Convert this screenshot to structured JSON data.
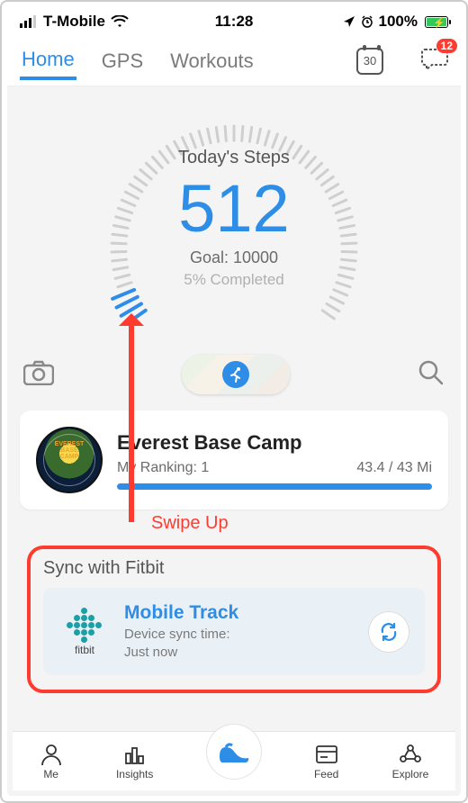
{
  "status": {
    "carrier": "T-Mobile",
    "time": "11:28",
    "battery_pct": "100%"
  },
  "topnav": {
    "tabs": [
      "Home",
      "GPS",
      "Workouts"
    ],
    "active_index": 0,
    "calendar_day": "30",
    "chat_badge": "12"
  },
  "gauge": {
    "label": "Today's Steps",
    "steps": "512",
    "goal_label": "Goal: 10000",
    "pct_label": "5% Completed",
    "pct_value": 5
  },
  "challenge": {
    "title": "Everest Base Camp",
    "patch_line1": "EVEREST",
    "patch_line2": "BASE CAMP",
    "ranking_label": "My Ranking: 1",
    "distance_label": "43.4 / 43 Mi",
    "progress_pct": 100
  },
  "annotation": {
    "swipe_label": "Swipe Up"
  },
  "sync": {
    "section_title": "Sync with Fitbit",
    "brand": "fitbit",
    "device_name": "Mobile Track",
    "sub_line1": "Device sync time:",
    "sub_line2": "Just now"
  },
  "tabbar": {
    "items": [
      "Me",
      "Insights",
      "",
      "Feed",
      "Explore"
    ]
  }
}
